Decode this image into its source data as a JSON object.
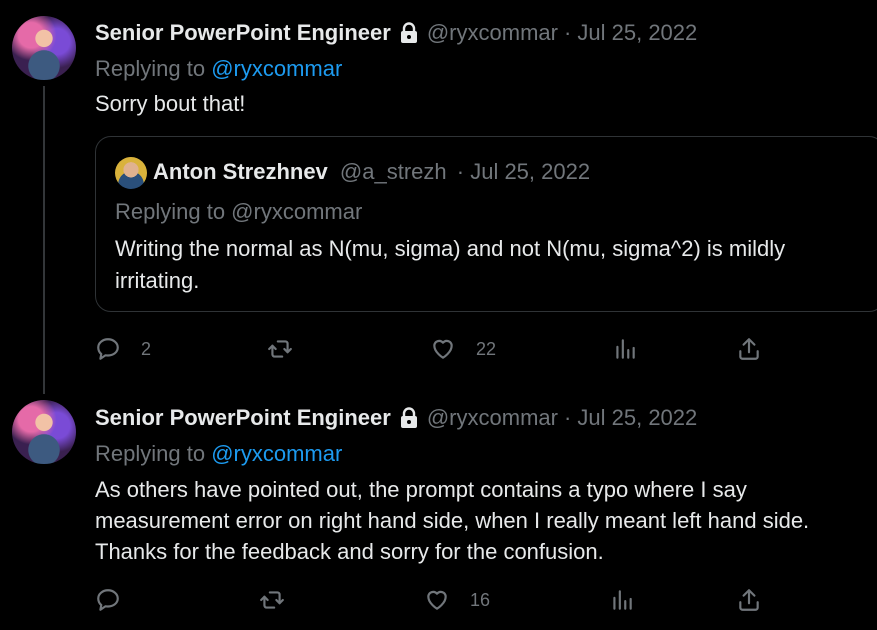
{
  "tweets": [
    {
      "name": "Senior PowerPoint Engineer",
      "handle": "@ryxcommar",
      "date": "· Jul 25, 2022",
      "replying_label": "Replying to",
      "replying_to": "@ryxcommar",
      "text": "Sorry bout that!",
      "quote": {
        "name": "Anton Strezhnev",
        "handle": "@a_strezh",
        "date": "· Jul 25, 2022",
        "replying": "Replying to @ryxcommar",
        "text": "Writing the normal as N(mu, sigma) and not N(mu, sigma^2) is mildly irritating."
      },
      "actions": {
        "reply_count": "2",
        "retweet_count": "",
        "like_count": "22"
      }
    },
    {
      "name": "Senior PowerPoint Engineer",
      "handle": "@ryxcommar",
      "date": "· Jul 25, 2022",
      "replying_label": "Replying to",
      "replying_to": "@ryxcommar",
      "text": "As others have pointed out, the prompt contains a typo where I say measurement error on right hand side, when I really meant left hand side. Thanks for the feedback and sorry for the confusion.",
      "actions": {
        "reply_count": "",
        "retweet_count": "",
        "like_count": "16"
      }
    }
  ],
  "icons": [
    "lock-icon",
    "reply-icon",
    "retweet-icon",
    "like-icon",
    "views-icon",
    "share-icon"
  ]
}
